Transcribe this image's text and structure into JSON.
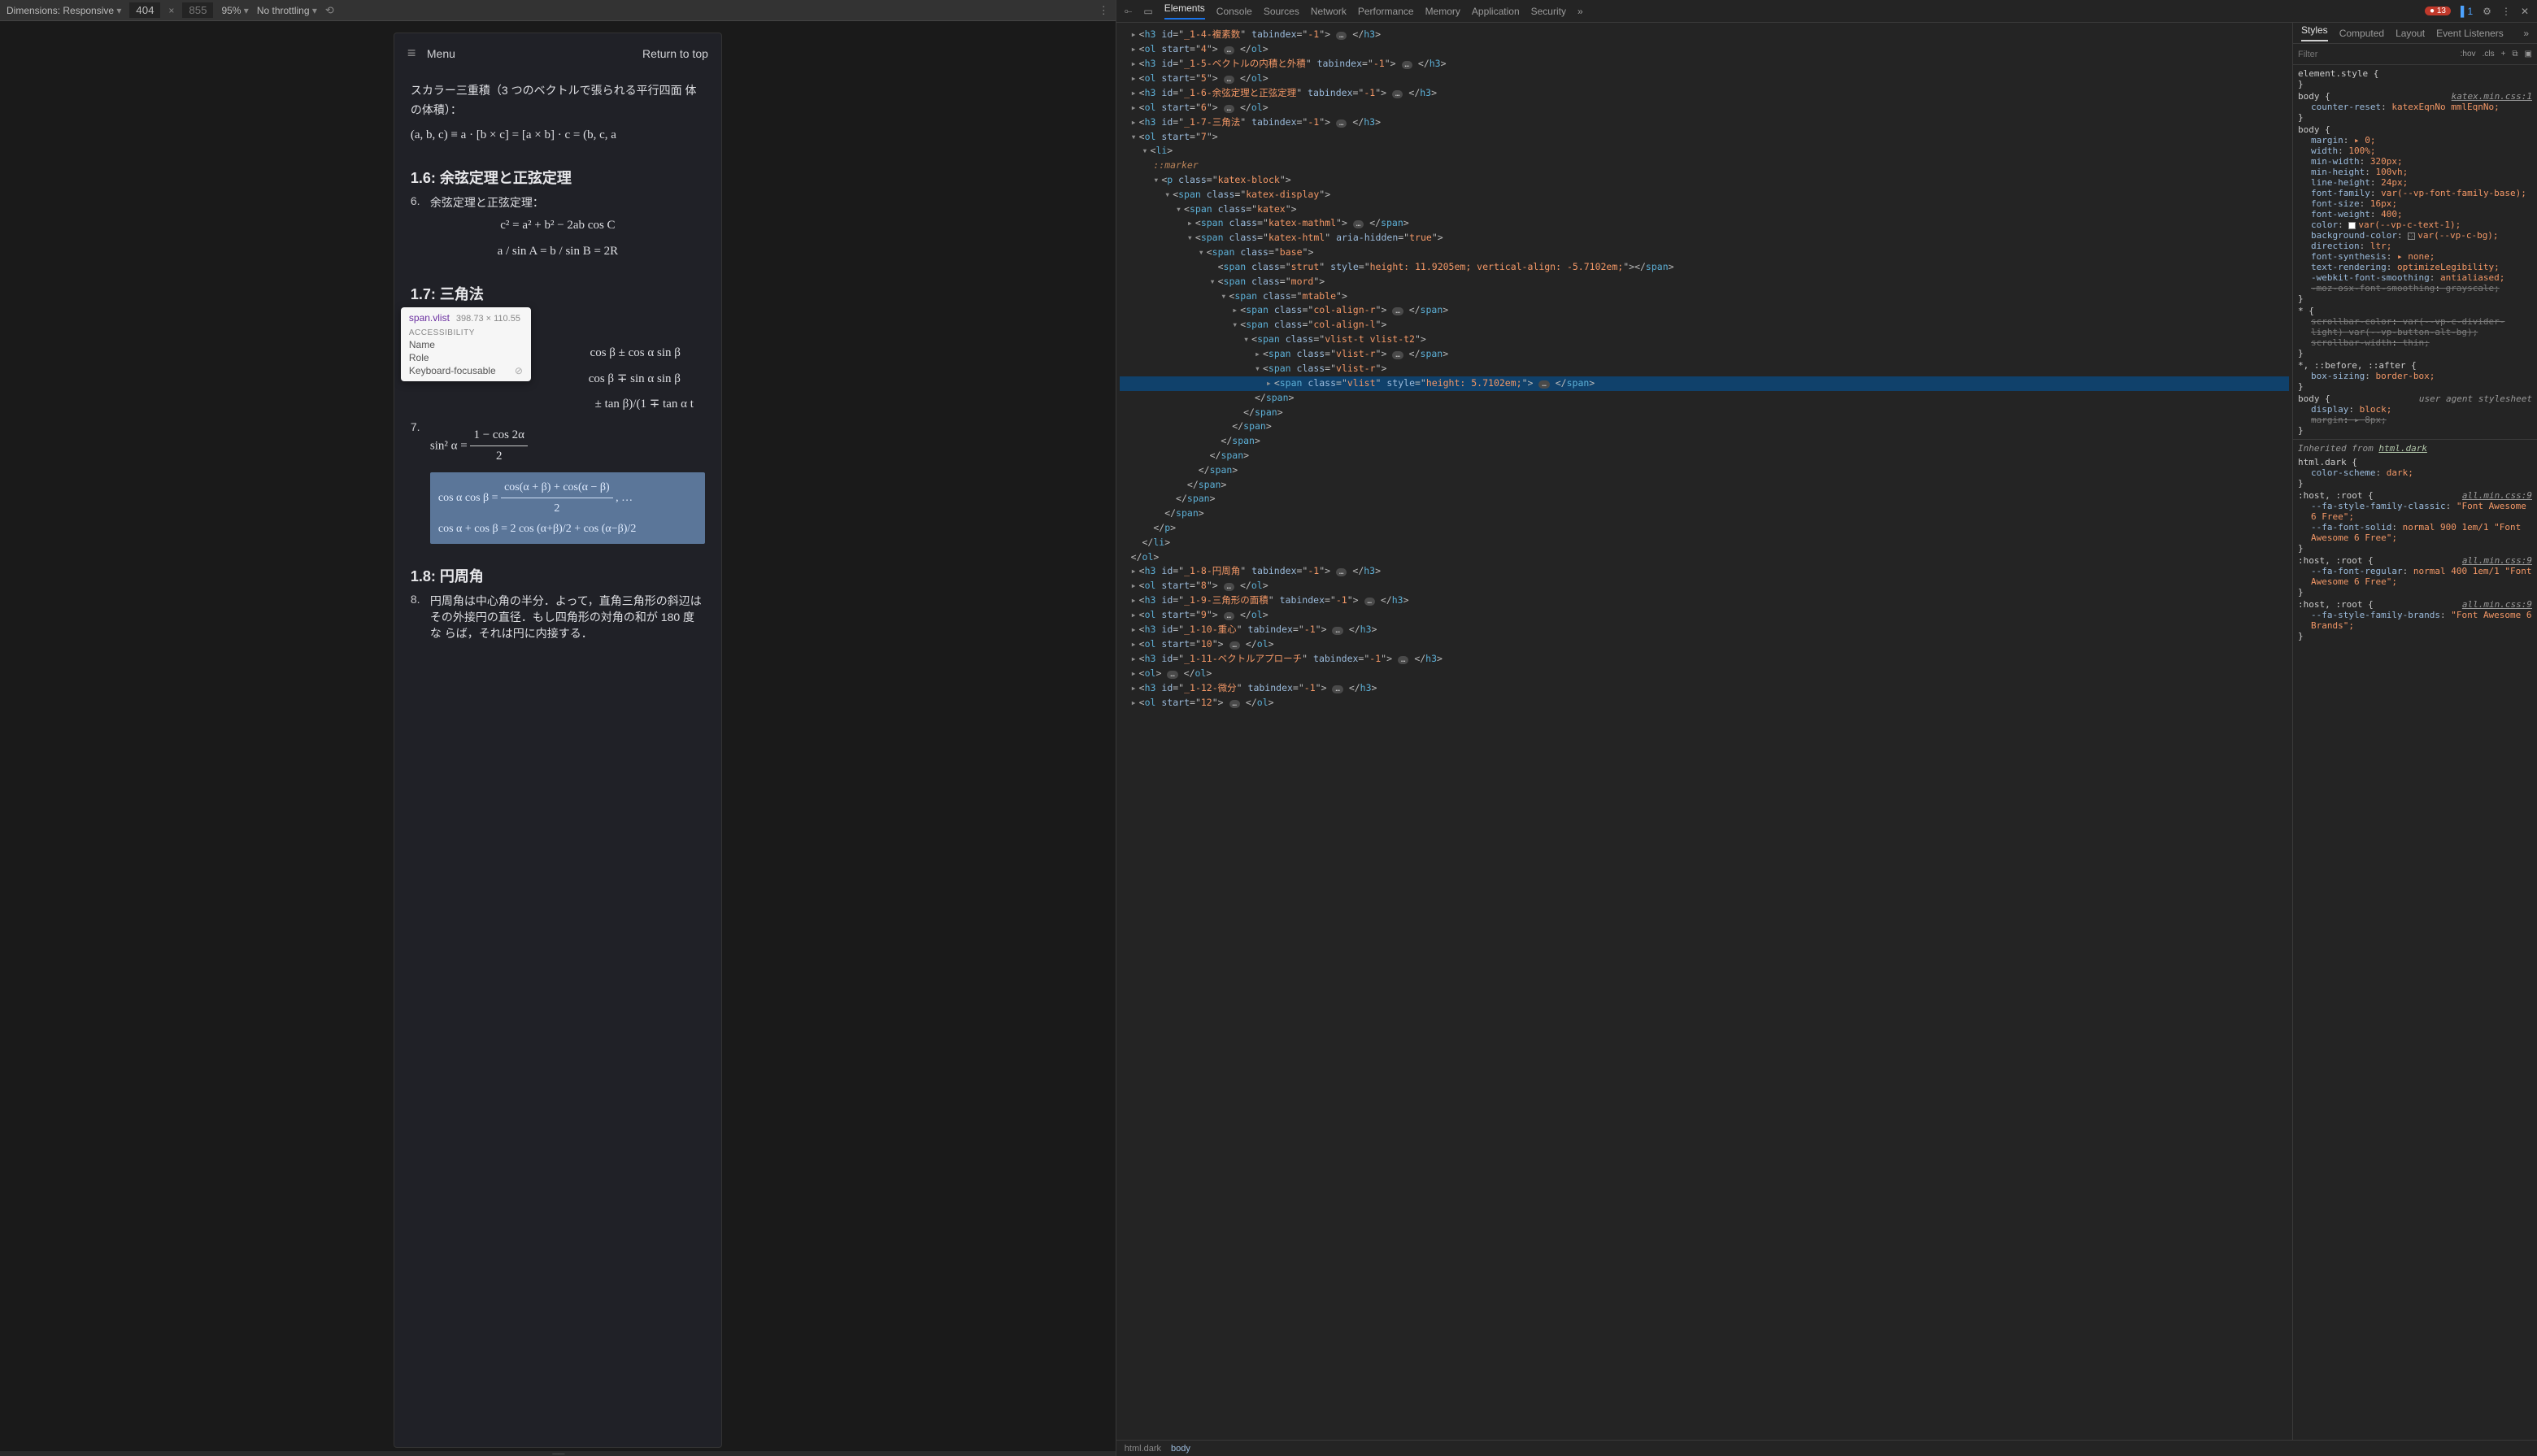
{
  "topbar": {
    "dimensions_label": "Dimensions: Responsive",
    "width": "404",
    "height": "855",
    "zoom": "95%",
    "throttling": "No throttling",
    "more": "⋮"
  },
  "devtools_tabs": {
    "inspect_active": true,
    "device_toggle_active": true,
    "tabs": [
      "Elements",
      "Console",
      "Sources",
      "Network",
      "Performance",
      "Memory",
      "Application",
      "Security"
    ],
    "active": "Elements",
    "errors": "13",
    "info": "1"
  },
  "doc": {
    "menu_label": "Menu",
    "return_label": "Return to top",
    "p_scalar": "スカラー三重積（3 つのベクトルで張られる平行四面 体の体積）：",
    "f_scalar": "(a, b, c) ≡ a · [b × c] = [a × b] · c = (b, c, a",
    "h16": "1.6: 余弦定理と正弦定理",
    "li6_n": "6.",
    "li6_t": "余弦定理と正弦定理：",
    "f_cos": "c² = a² + b² − 2ab cos C",
    "f_sin": "a / sin A = b / sin B = 2R",
    "h17": "1.7: 三角法",
    "li7_n": "7.",
    "f_t1": "sin² α =",
    "f_t1b": "1 − cos 2α",
    "hl_l1": "cos α cos β = ",
    "hl_l1b": "cos(α + β) + cos(α − β)",
    "hl_l2": "cos α + cos β = 2  cos (α+β)/2 + cos (α−β)/2",
    "h18": "1.8: 円周角",
    "li8_n": "8.",
    "li8_t": "円周角は中心角の半分．よって，直角三角形の斜辺は その外接円の直径．もし四角形の対角の和が 180 度な らば，それは円に内接する．",
    "f_hidden1": "cos β ± cos α sin β",
    "f_hidden2": "cos β ∓ sin α sin β",
    "f_hidden3": "± tan β)/(1 ∓ tan α t"
  },
  "tooltip": {
    "selector": "span.vlist",
    "dims": "398.73 × 110.55",
    "section": "ACCESSIBILITY",
    "rows": [
      "Name",
      "Role",
      "Keyboard-focusable"
    ]
  },
  "dom_lines": [
    {
      "i": 1,
      "t": "▸",
      "pre": "",
      "tag": "h3",
      "attrs": [
        [
          "id",
          "_1-4-複素数"
        ],
        [
          "tabindex",
          "-1"
        ]
      ],
      "after": "…",
      "close": "h3"
    },
    {
      "i": 1,
      "t": "▸",
      "pre": "",
      "tag": "ol",
      "attrs": [
        [
          "start",
          "4"
        ]
      ],
      "after": "…",
      "close": "ol"
    },
    {
      "i": 1,
      "t": "▸",
      "pre": "",
      "tag": "h3",
      "attrs": [
        [
          "id",
          "_1-5-ベクトルの内積と外積"
        ],
        [
          "tabindex",
          "-1"
        ]
      ],
      "after": "…",
      "close": "h3"
    },
    {
      "i": 1,
      "t": "▸",
      "pre": "",
      "tag": "ol",
      "attrs": [
        [
          "start",
          "5"
        ]
      ],
      "after": "…",
      "close": "ol"
    },
    {
      "i": 1,
      "t": "▸",
      "pre": "",
      "tag": "h3",
      "attrs": [
        [
          "id",
          "_1-6-余弦定理と正弦定理"
        ],
        [
          "tabindex",
          "-1"
        ]
      ],
      "after": "…",
      "close": "h3"
    },
    {
      "i": 1,
      "t": "▸",
      "pre": "",
      "tag": "ol",
      "attrs": [
        [
          "start",
          "6"
        ]
      ],
      "after": "…",
      "close": "ol"
    },
    {
      "i": 1,
      "t": "▸",
      "pre": "",
      "tag": "h3",
      "attrs": [
        [
          "id",
          "_1-7-三角法"
        ],
        [
          "tabindex",
          "-1"
        ]
      ],
      "after": "…",
      "close": "h3"
    },
    {
      "i": 1,
      "t": "▾",
      "pre": "",
      "tag": "ol",
      "attrs": [
        [
          "start",
          "7"
        ]
      ],
      "after": "",
      "close": ""
    },
    {
      "i": 2,
      "t": "▾",
      "pre": "",
      "tag": "li",
      "attrs": [],
      "after": "",
      "close": ""
    },
    {
      "i": 3,
      "t": "",
      "pre": "",
      "raw": "::marker",
      "marker": true
    },
    {
      "i": 3,
      "t": "▾",
      "pre": "",
      "tag": "p",
      "attrs": [
        [
          "class",
          "katex-block"
        ]
      ],
      "after": "",
      "close": ""
    },
    {
      "i": 4,
      "t": "▾",
      "pre": "",
      "tag": "span",
      "attrs": [
        [
          "class",
          "katex-display"
        ]
      ],
      "after": "",
      "close": ""
    },
    {
      "i": 5,
      "t": "▾",
      "pre": "",
      "tag": "span",
      "attrs": [
        [
          "class",
          "katex"
        ]
      ],
      "after": "",
      "close": ""
    },
    {
      "i": 6,
      "t": "▸",
      "pre": "",
      "tag": "span",
      "attrs": [
        [
          "class",
          "katex-mathml"
        ]
      ],
      "after": "…",
      "close": "span"
    },
    {
      "i": 6,
      "t": "▾",
      "pre": "",
      "tag": "span",
      "attrs": [
        [
          "class",
          "katex-html"
        ],
        [
          "aria-hidden",
          "true"
        ]
      ],
      "after": "",
      "close": ""
    },
    {
      "i": 7,
      "t": "▾",
      "pre": "",
      "tag": "span",
      "attrs": [
        [
          "class",
          "base"
        ]
      ],
      "after": "",
      "close": ""
    },
    {
      "i": 8,
      "t": "",
      "pre": "",
      "tag": "span",
      "attrs": [
        [
          "class",
          "strut"
        ],
        [
          "style",
          "height: 11.9205em; vertical-align: -5.7102em;"
        ]
      ],
      "after": "",
      "close": "span",
      "oneline": true
    },
    {
      "i": 8,
      "t": "▾",
      "pre": "",
      "tag": "span",
      "attrs": [
        [
          "class",
          "mord"
        ]
      ],
      "after": "",
      "close": ""
    },
    {
      "i": 9,
      "t": "▾",
      "pre": "",
      "tag": "span",
      "attrs": [
        [
          "class",
          "mtable"
        ]
      ],
      "after": "",
      "close": ""
    },
    {
      "i": 10,
      "t": "▸",
      "pre": "",
      "tag": "span",
      "attrs": [
        [
          "class",
          "col-align-r"
        ]
      ],
      "after": "…",
      "close": "span"
    },
    {
      "i": 10,
      "t": "▾",
      "pre": "",
      "tag": "span",
      "attrs": [
        [
          "class",
          "col-align-l"
        ]
      ],
      "after": "",
      "close": ""
    },
    {
      "i": 11,
      "t": "▾",
      "pre": "",
      "tag": "span",
      "attrs": [
        [
          "class",
          "vlist-t vlist-t2"
        ]
      ],
      "after": "",
      "close": ""
    },
    {
      "i": 12,
      "t": "▸",
      "pre": "",
      "tag": "span",
      "attrs": [
        [
          "class",
          "vlist-r"
        ]
      ],
      "after": "…",
      "close": "span"
    },
    {
      "i": 12,
      "t": "▾",
      "pre": "",
      "tag": "span",
      "attrs": [
        [
          "class",
          "vlist-r"
        ]
      ],
      "after": "",
      "close": ""
    },
    {
      "i": 13,
      "t": "▸",
      "pre": "",
      "tag": "span",
      "attrs": [
        [
          "class",
          "vlist"
        ],
        [
          "style",
          "height: 5.7102em;"
        ]
      ],
      "after": "…",
      "close": "span",
      "sel": true
    },
    {
      "i": 12,
      "t": "",
      "closeOnly": "span"
    },
    {
      "i": 11,
      "t": "",
      "closeOnly": "span"
    },
    {
      "i": 10,
      "t": "",
      "closeOnly": "span"
    },
    {
      "i": 9,
      "t": "",
      "closeOnly": "span"
    },
    {
      "i": 8,
      "t": "",
      "closeOnly": "span"
    },
    {
      "i": 7,
      "t": "",
      "closeOnly": "span"
    },
    {
      "i": 6,
      "t": "",
      "closeOnly": "span"
    },
    {
      "i": 5,
      "t": "",
      "closeOnly": "span"
    },
    {
      "i": 4,
      "t": "",
      "closeOnly": "span"
    },
    {
      "i": 3,
      "t": "",
      "closeOnly": "p"
    },
    {
      "i": 2,
      "t": "",
      "closeOnly": "li"
    },
    {
      "i": 1,
      "t": "",
      "closeOnly": "ol"
    },
    {
      "i": 1,
      "t": "▸",
      "pre": "",
      "tag": "h3",
      "attrs": [
        [
          "id",
          "_1-8-円周角"
        ],
        [
          "tabindex",
          "-1"
        ]
      ],
      "after": "…",
      "close": "h3"
    },
    {
      "i": 1,
      "t": "▸",
      "pre": "",
      "tag": "ol",
      "attrs": [
        [
          "start",
          "8"
        ]
      ],
      "after": "…",
      "close": "ol"
    },
    {
      "i": 1,
      "t": "▸",
      "pre": "",
      "tag": "h3",
      "attrs": [
        [
          "id",
          "_1-9-三角形の面積"
        ],
        [
          "tabindex",
          "-1"
        ]
      ],
      "after": "…",
      "close": "h3"
    },
    {
      "i": 1,
      "t": "▸",
      "pre": "",
      "tag": "ol",
      "attrs": [
        [
          "start",
          "9"
        ]
      ],
      "after": "…",
      "close": "ol"
    },
    {
      "i": 1,
      "t": "▸",
      "pre": "",
      "tag": "h3",
      "attrs": [
        [
          "id",
          "_1-10-重心"
        ],
        [
          "tabindex",
          "-1"
        ]
      ],
      "after": "…",
      "close": "h3"
    },
    {
      "i": 1,
      "t": "▸",
      "pre": "",
      "tag": "ol",
      "attrs": [
        [
          "start",
          "10"
        ]
      ],
      "after": "…",
      "close": "ol"
    },
    {
      "i": 1,
      "t": "▸",
      "pre": "",
      "tag": "h3",
      "attrs": [
        [
          "id",
          "_1-11-ベクトルアプローチ"
        ],
        [
          "tabindex",
          "-1"
        ]
      ],
      "after": "…",
      "close": "h3"
    },
    {
      "i": 1,
      "t": "▸",
      "pre": "",
      "tag": "ol",
      "attrs": [],
      "after": "…",
      "close": "ol"
    },
    {
      "i": 1,
      "t": "▸",
      "pre": "",
      "tag": "h3",
      "attrs": [
        [
          "id",
          "_1-12-微分"
        ],
        [
          "tabindex",
          "-1"
        ]
      ],
      "after": "…",
      "close": "h3"
    },
    {
      "i": 1,
      "t": "▸",
      "pre": "",
      "tag": "ol",
      "attrs": [
        [
          "start",
          "12"
        ]
      ],
      "after": "…",
      "close": "ol"
    }
  ],
  "styles_subtabs": [
    "Styles",
    "Computed",
    "Layout",
    "Event Listeners"
  ],
  "styles_active": "Styles",
  "filter_placeholder": "Filter",
  "filter_chips": [
    ":hov",
    ".cls",
    "+"
  ],
  "rules": [
    {
      "sel": "element.style",
      "src": "",
      "props": []
    },
    {
      "sel": "body",
      "src": "katex.min.css:1",
      "props": [
        [
          "counter-reset",
          "katexEqnNo mmlEqnNo;"
        ]
      ]
    },
    {
      "sel": "body",
      "src": "<style>",
      "props": [
        [
          "margin",
          "▸ 0;"
        ],
        [
          "width",
          "100%;"
        ],
        [
          "min-width",
          "320px;"
        ],
        [
          "min-height",
          "100vh;"
        ],
        [
          "line-height",
          "24px;"
        ],
        [
          "font-family",
          "var(--vp-font-family-base);"
        ],
        [
          "font-size",
          "16px;"
        ],
        [
          "font-weight",
          "400;"
        ],
        [
          "color",
          "var(--vp-c-text-1);",
          "white"
        ],
        [
          "background-color",
          "var(--vp-c-bg);",
          "trans"
        ],
        [
          "direction",
          "ltr;"
        ],
        [
          "font-synthesis",
          "▸ none;"
        ],
        [
          "text-rendering",
          "optimizeLegibility;"
        ],
        [
          "-webkit-font-smoothing",
          "antialiased;"
        ],
        [
          "-moz-osx-font-smoothing",
          "grayscale;",
          "",
          "strike"
        ]
      ]
    },
    {
      "sel": "*",
      "src": "<style>",
      "props": [
        [
          "scrollbar-color",
          "var(--vp-c-divider-light) var(--vp-button-alt-bg);",
          "",
          "strike"
        ],
        [
          "scrollbar-width",
          "thin;",
          "",
          "strike"
        ]
      ]
    },
    {
      "sel": "*, ::before, ::after",
      "src": "<style>",
      "props": [
        [
          "box-sizing",
          "border-box;"
        ]
      ]
    },
    {
      "sel": "body",
      "src": "user agent stylesheet",
      "props": [
        [
          "display",
          "block;"
        ],
        [
          "margin",
          "▸ 8px;",
          "",
          "strike"
        ]
      ]
    }
  ],
  "inherited_label": "Inherited from ",
  "inherited_from": "html.dark",
  "irules": [
    {
      "sel": "html.dark",
      "src": "<style>",
      "props": [
        [
          "color-scheme",
          "dark;"
        ]
      ]
    },
    {
      "sel": ":host, :root",
      "src": "all.min.css:9",
      "props": [
        [
          "--fa-style-family-classic",
          "\"Font Awesome 6 Free\";"
        ],
        [
          "--fa-font-solid",
          "normal 900 1em/1 \"Font Awesome 6 Free\";"
        ]
      ]
    },
    {
      "sel": ":host, :root",
      "src": "all.min.css:9",
      "props": [
        [
          "--fa-font-regular",
          "normal 400 1em/1 \"Font Awesome 6 Free\";"
        ]
      ]
    },
    {
      "sel": ":host, :root",
      "src": "all.min.css:9",
      "props": [
        [
          "--fa-style-family-brands",
          "\"Font Awesome 6 Brands\";"
        ]
      ]
    }
  ],
  "breadcrumb": [
    "html.dark",
    "body"
  ]
}
